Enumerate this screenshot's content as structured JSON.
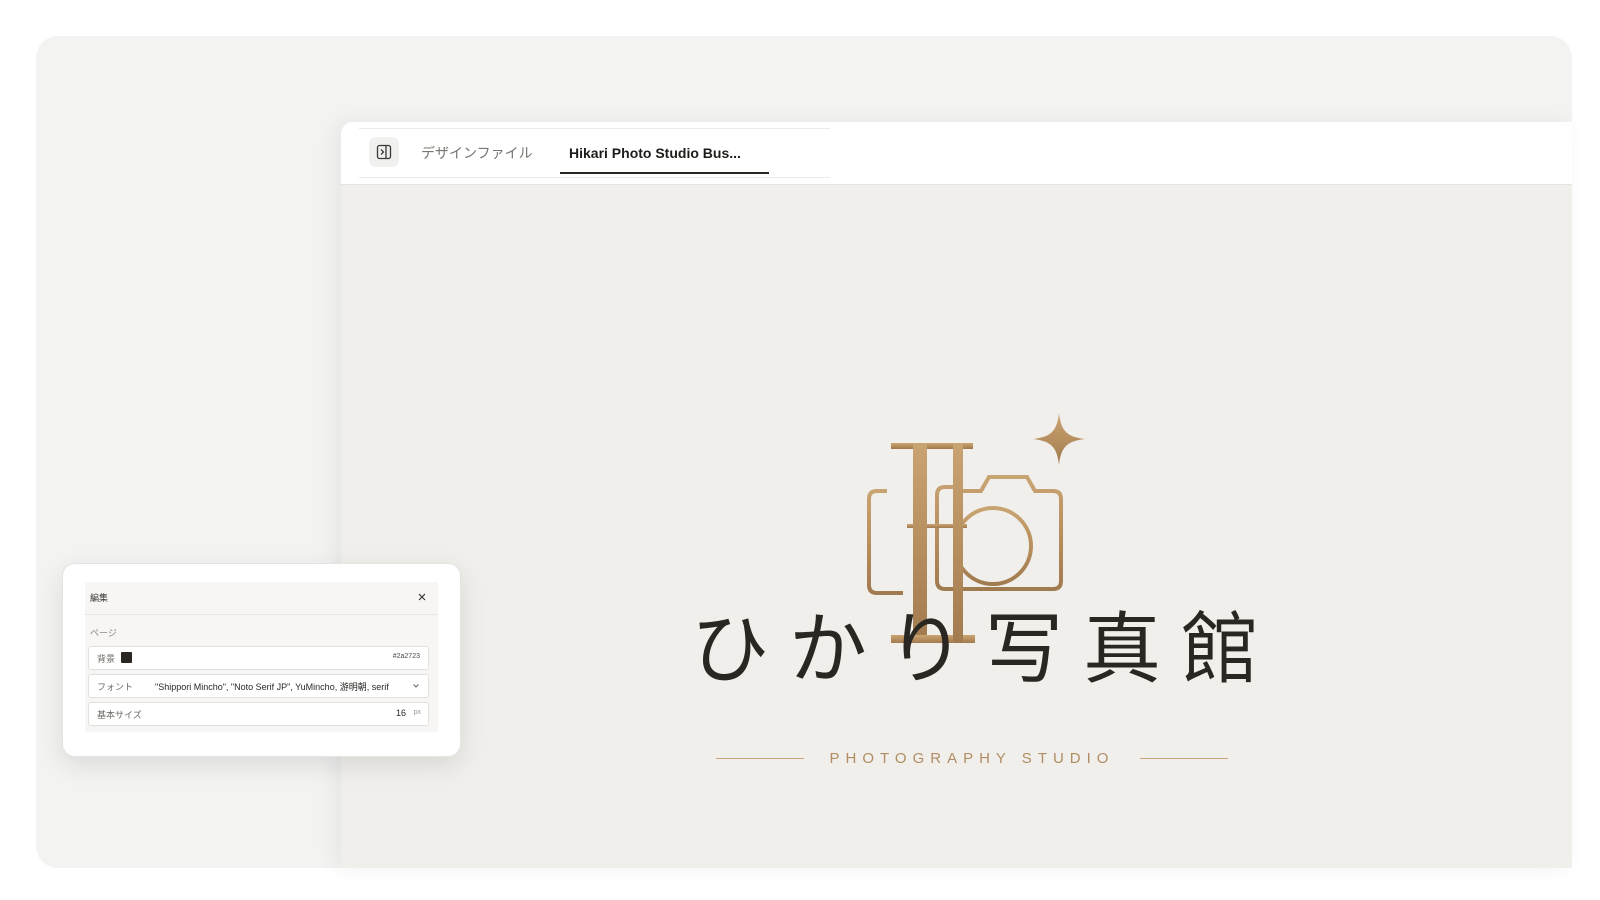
{
  "tabs": {
    "files_label": "デザインファイル",
    "active_label": "Hikari Photo Studio Bus..."
  },
  "logo": {
    "title": "ひかり写真館",
    "tagline": "PHOTOGRAPHY STUDIO",
    "accent_color": "#b8915f",
    "text_color": "#2a2723"
  },
  "editor": {
    "title": "編集",
    "section": "ページ",
    "background": {
      "label": "背景",
      "value": "#2a2723"
    },
    "font": {
      "label": "フォント",
      "value": "\"Shippori Mincho\", \"Noto Serif JP\", YuMincho, 游明朝, serif"
    },
    "base_size": {
      "label": "基本サイズ",
      "value": "16",
      "unit": "px"
    }
  },
  "icons": [
    "sidebar-toggle-icon",
    "close-icon",
    "chevron-down-icon",
    "camera-logo-icon",
    "sparkle-icon"
  ]
}
